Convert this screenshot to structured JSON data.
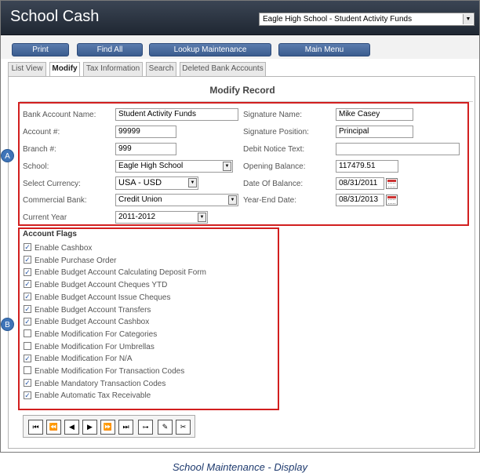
{
  "app": {
    "title": "School Cash",
    "school_selector": "Eagle High School - Student Activity Funds"
  },
  "nav_buttons": {
    "print": "Print",
    "find_all": "Find All",
    "lookup": "Lookup Maintenance",
    "main_menu": "Main Menu"
  },
  "tabs": {
    "list_view": "List View",
    "modify": "Modify",
    "tax_information": "Tax Information",
    "search": "Search",
    "deleted_bank_accounts": "Deleted Bank Accounts"
  },
  "section_title": "Modify Record",
  "form": {
    "bank_account_name": {
      "label": "Bank Account Name:",
      "value": "Student Activity Funds"
    },
    "account_number": {
      "label": "Account #:",
      "value": "99999"
    },
    "branch_number": {
      "label": "Branch #:",
      "value": "999"
    },
    "school": {
      "label": "School:",
      "value": "Eagle High School"
    },
    "select_currency": {
      "label": "Select Currency:",
      "value": "USA - USD"
    },
    "commercial_bank": {
      "label": "Commercial Bank:",
      "value": "Credit Union"
    },
    "current_year": {
      "label": "Current Year",
      "value": "2011-2012"
    },
    "signature_name": {
      "label": "Signature Name:",
      "value": "Mike Casey"
    },
    "signature_position": {
      "label": "Signature Position:",
      "value": "Principal"
    },
    "debit_notice_text": {
      "label": "Debit Notice Text:",
      "value": ""
    },
    "opening_balance": {
      "label": "Opening Balance:",
      "value": "117479.51"
    },
    "date_of_balance": {
      "label": "Date Of Balance:",
      "value": "08/31/2011"
    },
    "year_end_date": {
      "label": "Year-End Date:",
      "value": "08/31/2013"
    }
  },
  "badges": {
    "a": "A",
    "b": "B"
  },
  "account_flags": {
    "title": "Account Flags",
    "items": [
      {
        "label": "Enable Cashbox",
        "checked": true,
        "mark": "✓"
      },
      {
        "label": "Enable Purchase Order",
        "checked": true,
        "mark": "✓"
      },
      {
        "label": "Enable Budget Account Calculating Deposit Form",
        "checked": true,
        "mark": "✓"
      },
      {
        "label": "Enable Budget Account Cheques YTD",
        "checked": true,
        "mark": "✓"
      },
      {
        "label": "Enable Budget Account Issue Cheques",
        "checked": true,
        "mark": "✓"
      },
      {
        "label": "Enable Budget Account Transfers",
        "checked": true,
        "mark": "✓"
      },
      {
        "label": "Enable Budget Account Cashbox",
        "checked": true,
        "mark": "✓"
      },
      {
        "label": "Enable Modification For Categories",
        "checked": false,
        "mark": ""
      },
      {
        "label": "Enable Modification For Umbrellas",
        "checked": false,
        "mark": ""
      },
      {
        "label": "Enable Modification For N/A",
        "checked": true,
        "mark": "✓"
      },
      {
        "label": "Enable Modification For Transaction Codes",
        "checked": false,
        "mark": ""
      },
      {
        "label": "Enable Mandatory Transaction Codes",
        "checked": true,
        "mark": "✓"
      },
      {
        "label": "Enable Automatic Tax Receivable",
        "checked": true,
        "mark": "✓"
      }
    ]
  },
  "pager_icons": {
    "first": "first-record-icon",
    "prev_page": "previous-page-icon",
    "prev": "previous-record-icon",
    "next": "next-record-icon",
    "next_page": "next-page-icon",
    "last": "last-record-icon",
    "link": "link-icon",
    "edit": "edit-icon",
    "delete": "delete-icon"
  },
  "colors": {
    "header_bg": "#2a323e",
    "nav_button": "#4a6b9e",
    "highlight_box": "#d21f1f",
    "badge": "#3e74b8"
  },
  "caption": "School Maintenance - Display"
}
